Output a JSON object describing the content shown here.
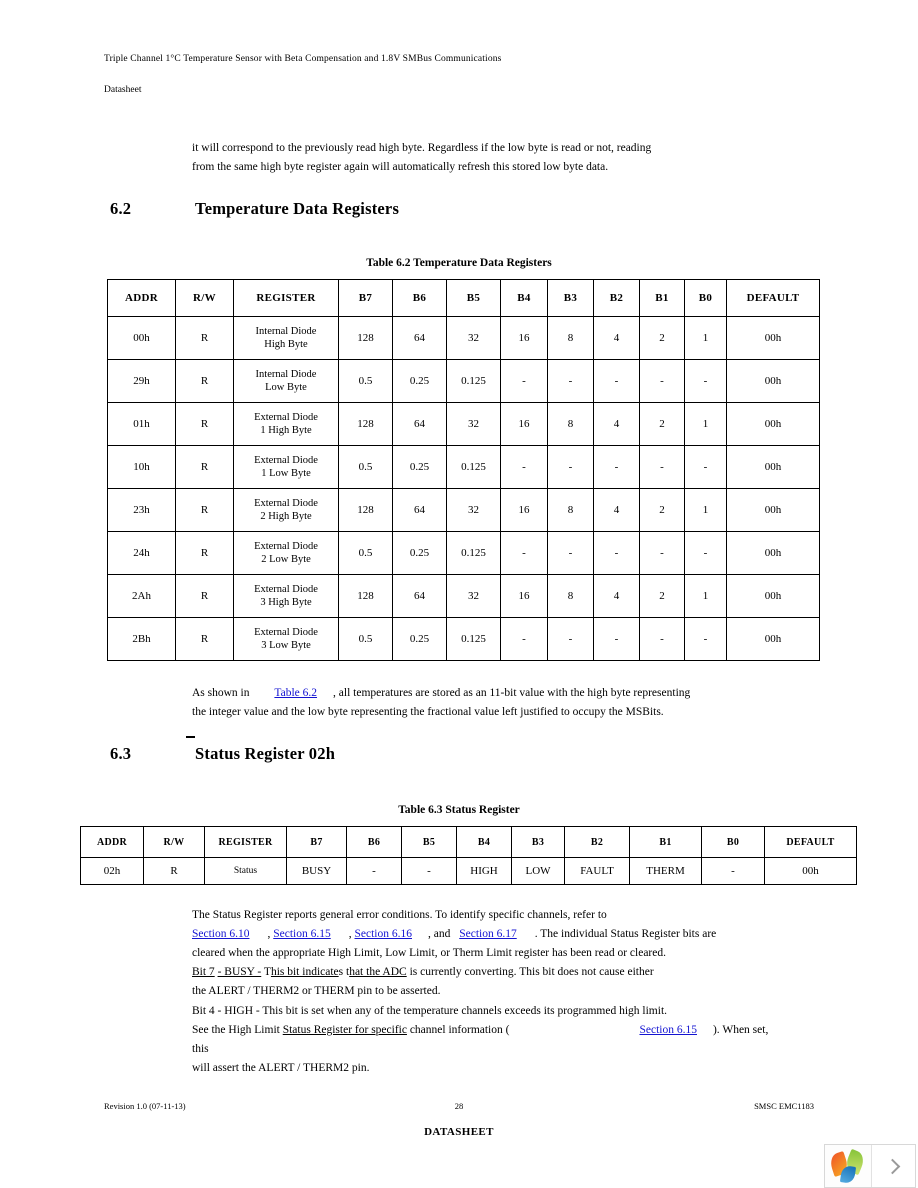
{
  "header": {
    "title": "Triple Channel 1°C Temperature Sensor with Beta Compensation and 1.8V SMBus Communications",
    "subtitle": "Datasheet"
  },
  "intro_paragraph": {
    "line1": "it will correspond to the previously read high byte. Regardless if the low byte is read or not, reading",
    "line2": "from the same high byte register again will automatically refresh this stored low byte data."
  },
  "section_62": {
    "number": "6.2",
    "title": "Temperature Data Registers"
  },
  "table_62": {
    "caption": "Table 6.2  Temperature Data Registers",
    "columns": [
      "ADDR",
      "R/W",
      "REGISTER",
      "B7",
      "B6",
      "B5",
      "B4",
      "B3",
      "B2",
      "B1",
      "B0",
      "DEFAULT"
    ],
    "rows": [
      {
        "addr": "00h",
        "rw": "R",
        "name_l1": "Internal Diode",
        "name_l2": "High Byte",
        "b7": "128",
        "b6": "64",
        "b5": "32",
        "b4": "16",
        "b3": "8",
        "b2": "4",
        "b1": "2",
        "b0": "1",
        "default": "00h"
      },
      {
        "addr": "29h",
        "rw": "R",
        "name_l1": "Internal Diode",
        "name_l2": "Low Byte",
        "b7": "0.5",
        "b6": "0.25",
        "b5": "0.125",
        "b4": "-",
        "b3": "-",
        "b2": "-",
        "b1": "-",
        "b0": "-",
        "default": "00h"
      },
      {
        "addr": "01h",
        "rw": "R",
        "name_l1": "External Diode",
        "name_l2": "1 High Byte",
        "b7": "128",
        "b6": "64",
        "b5": "32",
        "b4": "16",
        "b3": "8",
        "b2": "4",
        "b1": "2",
        "b0": "1",
        "default": "00h"
      },
      {
        "addr": "10h",
        "rw": "R",
        "name_l1": "External Diode",
        "name_l2": "1 Low Byte",
        "b7": "0.5",
        "b6": "0.25",
        "b5": "0.125",
        "b4": "-",
        "b3": "-",
        "b2": "-",
        "b1": "-",
        "b0": "-",
        "default": "00h"
      },
      {
        "addr": "23h",
        "rw": "R",
        "name_l1": "External Diode",
        "name_l2": "2 High Byte",
        "b7": "128",
        "b6": "64",
        "b5": "32",
        "b4": "16",
        "b3": "8",
        "b2": "4",
        "b1": "2",
        "b0": "1",
        "default": "00h"
      },
      {
        "addr": "24h",
        "rw": "R",
        "name_l1": "External Diode",
        "name_l2": "2 Low Byte",
        "b7": "0.5",
        "b6": "0.25",
        "b5": "0.125",
        "b4": "-",
        "b3": "-",
        "b2": "-",
        "b1": "-",
        "b0": "-",
        "default": "00h"
      },
      {
        "addr": "2Ah",
        "rw": "R",
        "name_l1": "External Diode",
        "name_l2": "3 High Byte",
        "b7": "128",
        "b6": "64",
        "b5": "32",
        "b4": "16",
        "b3": "8",
        "b2": "4",
        "b1": "2",
        "b0": "1",
        "default": "00h"
      },
      {
        "addr": "2Bh",
        "rw": "R",
        "name_l1": "External Diode",
        "name_l2": "3 Low Byte",
        "b7": "0.5",
        "b6": "0.25",
        "b5": "0.125",
        "b4": "-",
        "b3": "-",
        "b2": "-",
        "b1": "-",
        "b0": "-",
        "default": "00h"
      }
    ]
  },
  "after_table_62": {
    "lead": "As shown in",
    "link": "Table 6.2",
    "rest1": ", all temperatures are stored as an 11-bit value with the high byte representing",
    "line2": "the integer value and the low byte representing the fractional value left justified to occupy the MSBits."
  },
  "section_63": {
    "number": "6.3",
    "title": "Status Register 02h"
  },
  "table_63": {
    "caption": "Table 6.3  Status Register",
    "columns": [
      "ADDR",
      "R/W",
      "REGISTER",
      "B7",
      "B6",
      "B5",
      "B4",
      "B3",
      "B2",
      "B1",
      "B0",
      "DEFAULT"
    ],
    "rows": [
      {
        "addr": "02h",
        "rw": "R",
        "name": "Status",
        "b7": "BUSY",
        "b6": "-",
        "b5": "-",
        "b4": "HIGH",
        "b3": "LOW",
        "b2": "FAULT",
        "b1": "THERM",
        "b0": "-",
        "default": "00h"
      }
    ]
  },
  "status_description": {
    "line1": "The Status Register reports general error conditions. To identify specific channels, refer to",
    "link1": "Section 6.10",
    "sep1": ",",
    "link2": "Section 6.15",
    "sep2": ",",
    "link3": "Section 6.16",
    "sep3": ", and",
    "link4": "Section 6.17",
    "rest2": ". The individual Status Register bits are",
    "line3": "cleared when the appropriate High Limit, Low Limit, or Therm Limit register has been read or cleared."
  },
  "bit7_description": {
    "part1": "Bit 7",
    "underlined1": "- BUSY -",
    "part2": "T",
    "underlined2": "his bit indicate",
    "part3": "s t",
    "underlined3": "hat the ADC",
    "part4": "is currently converting. This bit does not cause either",
    "line2": "the ALERT / THERM2 or THERM pin to be asserted."
  },
  "bit4_description": {
    "line1": "Bit 4 - HIGH - This bit is set when any of the temperature channels exceeds its programmed high limit.",
    "line2_a": "See the High Limit",
    "line2_underlined": "Status Register for specific",
    "line2_b": "channel information (",
    "line2_link": "Section 6.15",
    "line2_c": "). When set, this",
    "line3": "will assert the ALERT / THERM2 pin."
  },
  "footer": {
    "revision": "Revision 1.0 (07-11-13)",
    "page": "28",
    "product": "SMSC EMC1183",
    "datasheet": "DATASHEET"
  },
  "widget": {
    "logo_icon": "pinwheel-logo-icon",
    "next_icon": "chevron-right-icon"
  }
}
